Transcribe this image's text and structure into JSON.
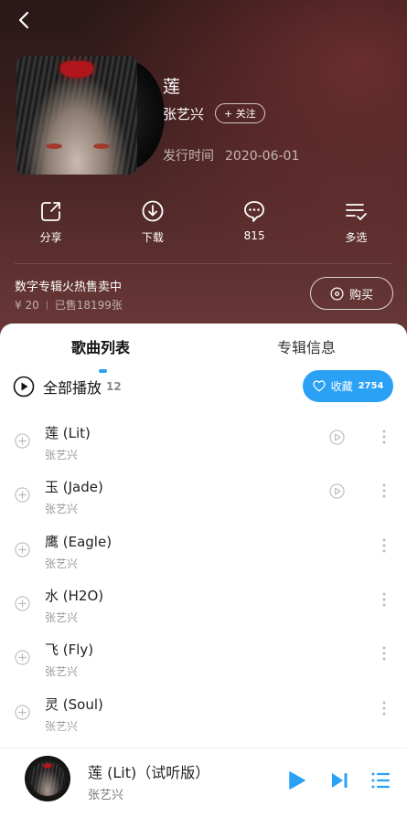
{
  "album": {
    "title": "莲",
    "artist": "张艺兴",
    "follow_label": "+ 关注",
    "release_label": "发行时间",
    "release_date": "2020-06-01"
  },
  "actions": [
    {
      "label": "分享",
      "icon": "share-icon"
    },
    {
      "label": "下载",
      "icon": "download-icon"
    },
    {
      "label": "815",
      "icon": "comment-icon"
    },
    {
      "label": "多选",
      "icon": "multiselect-icon"
    }
  ],
  "promo": {
    "title": "数字专辑火热售卖中",
    "price": "¥ 20",
    "sold": "已售18199张",
    "buy_label": "购买"
  },
  "tabs": {
    "songs": "歌曲列表",
    "info": "专辑信息"
  },
  "playall": {
    "label": "全部播放",
    "count": "12"
  },
  "collect": {
    "label": "收藏",
    "count": "2754"
  },
  "songs": [
    {
      "title": "莲 (Lit)",
      "artist": "张艺兴",
      "has_mv": true
    },
    {
      "title": "玉 (Jade)",
      "artist": "张艺兴",
      "has_mv": true
    },
    {
      "title": "鹰 (Eagle)",
      "artist": "张艺兴",
      "has_mv": false
    },
    {
      "title": "水 (H2O)",
      "artist": "张艺兴",
      "has_mv": false
    },
    {
      "title": "飞 (Fly)",
      "artist": "张艺兴",
      "has_mv": false
    },
    {
      "title": "灵 (Soul)",
      "artist": "张艺兴",
      "has_mv": false
    }
  ],
  "player": {
    "title": "莲 (Lit)（试听版）",
    "artist": "张艺兴"
  },
  "colors": {
    "accent": "#2ba1f5",
    "header_dark": "#2a1717"
  }
}
